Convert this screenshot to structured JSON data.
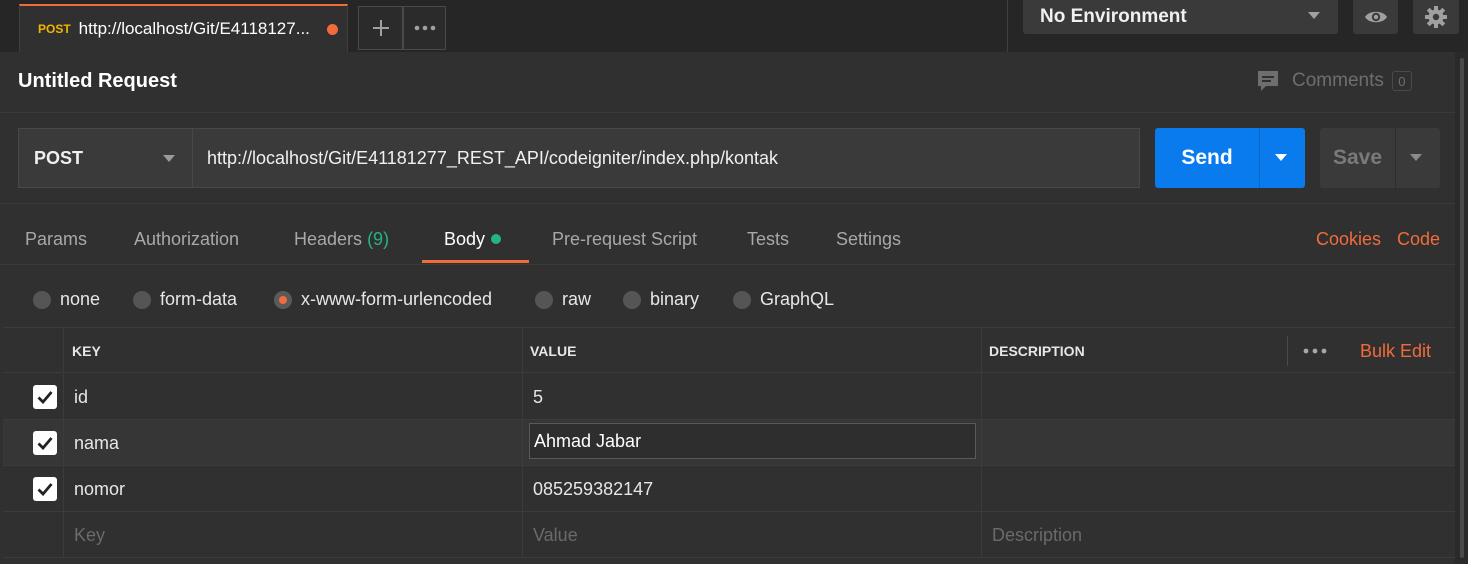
{
  "tabbar": {
    "active_tab": {
      "method": "POST",
      "title": "http://localhost/Git/E4118127..."
    },
    "add_tab_icon": "plus-icon",
    "more_icon": "ellipsis-icon",
    "environment": "No Environment"
  },
  "request": {
    "title": "Untitled Request",
    "comments_label": "Comments",
    "comments_count": "0",
    "method": "POST",
    "url": "http://localhost/Git/E41181277_REST_API/codeigniter/index.php/kontak",
    "send_label": "Send",
    "save_label": "Save"
  },
  "request_tabs": {
    "params": "Params",
    "authorization": "Authorization",
    "headers": "Headers",
    "headers_count": "(9)",
    "body": "Body",
    "prerequest": "Pre-request Script",
    "tests": "Tests",
    "settings": "Settings",
    "cookies": "Cookies",
    "code": "Code"
  },
  "body_types": {
    "none": "none",
    "form_data": "form-data",
    "urlencoded": "x-www-form-urlencoded",
    "raw": "raw",
    "binary": "binary",
    "graphql": "GraphQL",
    "selected": "x-www-form-urlencoded"
  },
  "params_table": {
    "headers": {
      "key": "KEY",
      "value": "VALUE",
      "description": "DESCRIPTION",
      "bulk_edit": "Bulk Edit"
    },
    "rows": [
      {
        "checked": true,
        "key": "id",
        "value": "5",
        "description": ""
      },
      {
        "checked": true,
        "key": "nama",
        "value": "Ahmad Jabar",
        "description": ""
      },
      {
        "checked": true,
        "key": "nomor",
        "value": "085259382147",
        "description": ""
      }
    ],
    "placeholders": {
      "key": "Key",
      "value": "Value",
      "description": "Description"
    }
  },
  "colors": {
    "accent_orange": "#f26b3a",
    "send_blue": "#097bed",
    "success_green": "#26b47f",
    "method_yellow": "#f4b400"
  }
}
